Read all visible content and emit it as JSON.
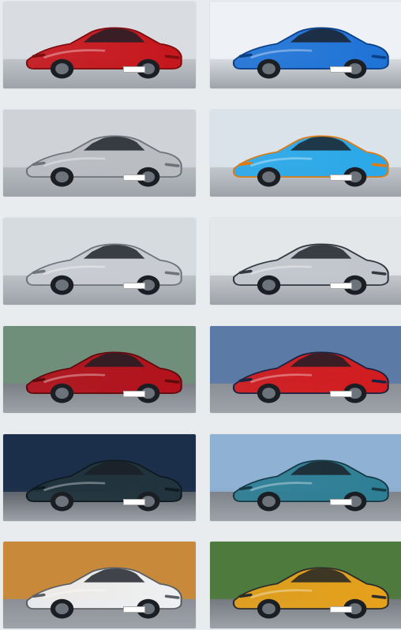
{
  "cards": [
    {
      "body": "#c5171d",
      "accent": "#7d0d10",
      "sky": "#d9dde2",
      "floor": "#bfc3c8"
    },
    {
      "body": "#1f73d6",
      "accent": "#0b3f86",
      "sky": "#eef1f5",
      "floor": "#d7dbe0"
    },
    {
      "body": "#b9bdc2",
      "accent": "#6f7378",
      "sky": "#cfd3d8",
      "floor": "#b7bbc0"
    },
    {
      "body": "#2aa8e8",
      "accent": "#e07a12",
      "sky": "#dbe3ea",
      "floor": "#c1c7cd"
    },
    {
      "body": "#c8ccd2",
      "accent": "#6f747a",
      "sky": "#d6dbe0",
      "floor": "#bcc1c6"
    },
    {
      "body": "#c1c6cc",
      "accent": "#333740",
      "sky": "#e4e7ea",
      "floor": "#c4c8cc"
    },
    {
      "body": "#b3121c",
      "accent": "#5e0a0f",
      "sky": "#6f8f7a",
      "floor": "#7b7f86"
    },
    {
      "body": "#d31c1f",
      "accent": "#1a2340",
      "sky": "#5b7aa6",
      "floor": "#8a8f95"
    },
    {
      "body": "#21343d",
      "accent": "#0f1a20",
      "sky": "#1b2f4a",
      "floor": "#5e646b"
    },
    {
      "body": "#2e7f95",
      "accent": "#163b47",
      "sky": "#8fb1d4",
      "floor": "#7e8389"
    },
    {
      "body": "#eef0f2",
      "accent": "#5c6066",
      "sky": "#c88a3a",
      "floor": "#8c9096"
    },
    {
      "body": "#e6a11c",
      "accent": "#2b2b2b",
      "sky": "#4f7a3e",
      "floor": "#757a80"
    }
  ]
}
